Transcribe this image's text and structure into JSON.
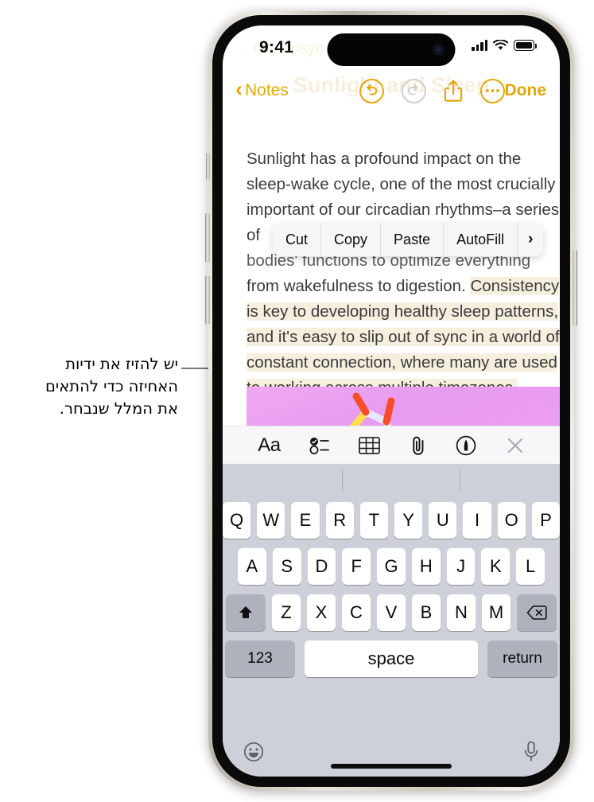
{
  "annotation": {
    "text_lines": [
      "יש להזיז את ידיות",
      "האחיזה כדי להתאים",
      "את המלל שנבחר."
    ]
  },
  "status_bar": {
    "time": "9:41",
    "ghost_tags": "#sc   #psyc",
    "signal_icon": "cellular-bars-icon",
    "wifi_icon": "wifi-icon",
    "battery_icon": "battery-icon"
  },
  "nav_bar": {
    "back_label": "Notes",
    "back_icon": "chevron-left-icon",
    "undo_icon": "undo-icon",
    "redo_icon": "redo-icon",
    "share_icon": "share-icon",
    "more_icon": "ellipsis-icon",
    "done_label": "Done",
    "ghost_title": "Sunlight and Sleep",
    "accent_color": "#e3a70a",
    "disabled_color": "#cfcfcf"
  },
  "note": {
    "paragraph_1": "Sunlight has a profound impact on the sleep-wake cycle, one of the most crucially important of our circadian rhythms–a series of",
    "hidden_line_1": "bodies' functions to optimize everything",
    "hidden_line_2": "from wakefulness to digestion. ",
    "selected_text": "Consistency is key to developing healthy sleep patterns, and it's easy to slip out of sync in a world of constant connection, where many are used to working across multiple timezones.",
    "selection_highlight_color": "#f6efdd",
    "handle_color": "#d9a413",
    "image_name": "molecule-image-attachment"
  },
  "edit_menu": {
    "items": [
      {
        "label": "Cut",
        "name": "cut-menu-item"
      },
      {
        "label": "Copy",
        "name": "copy-menu-item"
      },
      {
        "label": "Paste",
        "name": "paste-menu-item"
      },
      {
        "label": "AutoFill",
        "name": "autofill-menu-item"
      },
      {
        "label": "›",
        "name": "more-menu-item"
      }
    ]
  },
  "format_toolbar": {
    "items": [
      {
        "label": "Aa",
        "name": "text-format-icon"
      },
      {
        "label": "",
        "name": "checklist-icon"
      },
      {
        "label": "",
        "name": "table-icon"
      },
      {
        "label": "",
        "name": "attachment-paperclip-icon"
      },
      {
        "label": "",
        "name": "markup-pen-icon"
      },
      {
        "label": "",
        "name": "close-icon"
      }
    ]
  },
  "keyboard": {
    "row1": [
      "Q",
      "W",
      "E",
      "R",
      "T",
      "Y",
      "U",
      "I",
      "O",
      "P"
    ],
    "row2": [
      "A",
      "S",
      "D",
      "F",
      "G",
      "H",
      "J",
      "K",
      "L"
    ],
    "row3": [
      "Z",
      "X",
      "C",
      "V",
      "B",
      "N",
      "M"
    ],
    "shift_icon": "shift-up-arrow-icon",
    "delete_icon": "delete-backspace-icon",
    "numbers_label": "123",
    "space_label": "space",
    "return_label": "return",
    "emoji_icon": "emoji-smiley-icon",
    "dictation_icon": "microphone-icon"
  }
}
